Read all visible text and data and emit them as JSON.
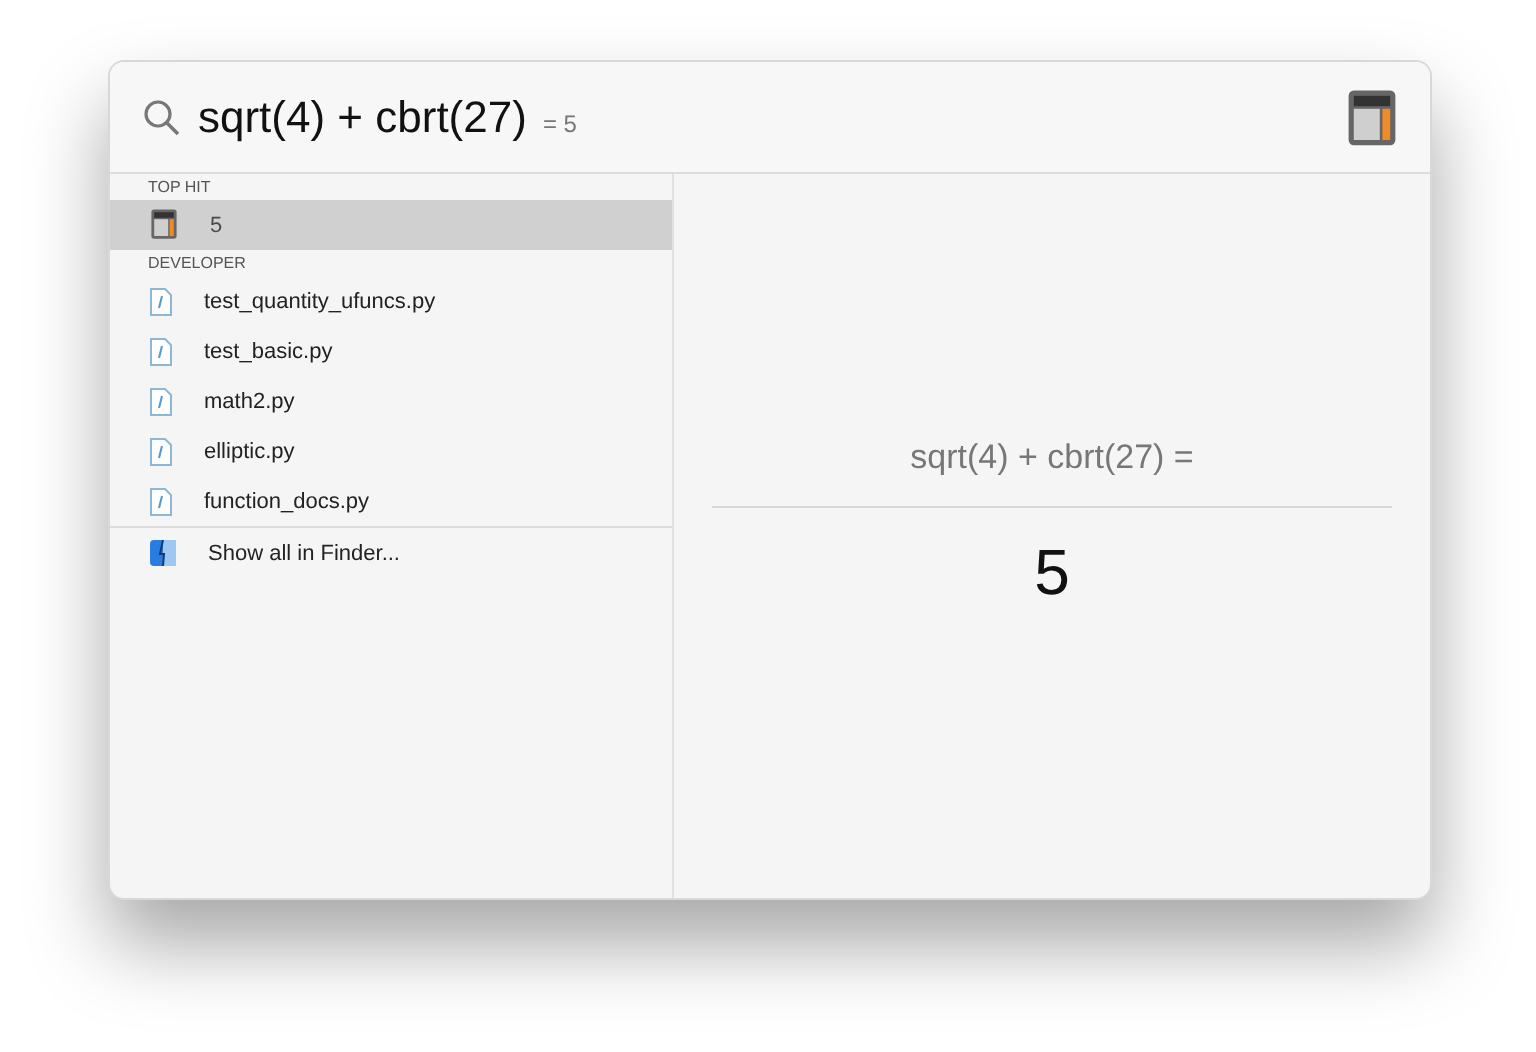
{
  "search": {
    "query": "sqrt(4) + cbrt(27)",
    "hint": "= 5"
  },
  "sections": [
    {
      "title": "TOP HIT",
      "items": [
        {
          "label": "5",
          "kind": "calculator",
          "selected": true
        }
      ]
    },
    {
      "title": "DEVELOPER",
      "items": [
        {
          "label": "test_quantity_ufuncs.py",
          "kind": "file",
          "selected": false
        },
        {
          "label": "test_basic.py",
          "kind": "file",
          "selected": false
        },
        {
          "label": "math2.py",
          "kind": "file",
          "selected": false
        },
        {
          "label": "elliptic.py",
          "kind": "file",
          "selected": false
        },
        {
          "label": "function_docs.py",
          "kind": "file",
          "selected": false
        }
      ]
    }
  ],
  "footer": {
    "label": "Show all in Finder...",
    "kind": "finder"
  },
  "preview": {
    "expression": "sqrt(4) + cbrt(27) =",
    "result": "5"
  }
}
